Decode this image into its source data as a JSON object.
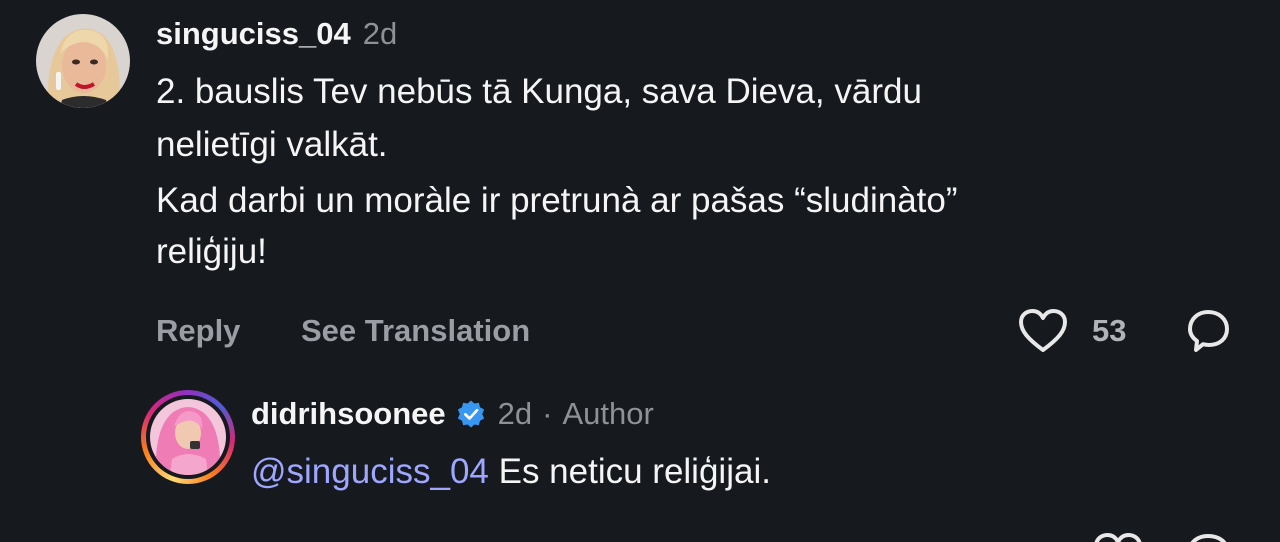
{
  "comments": [
    {
      "username": "singuciss_04",
      "time": "2d",
      "lines": [
        "2. bauslis Tev nebūs tā Kunga, sava Dieva, vārdu",
        "nelietīgi valkāt.",
        "Kad darbi un moràle ir pretrunà ar pašas “sludinàto”",
        "reliģiju!"
      ],
      "reply_label": "Reply",
      "translate_label": "See Translation",
      "likes": "53",
      "icons": [
        "avatar",
        "heart-icon",
        "chat-bubble-icon"
      ]
    },
    {
      "username": "didrihsoonee",
      "verified": true,
      "time": "2d",
      "separator": "·",
      "author_label": "Author",
      "mention": "@singuciss_04",
      "text": " Es neticu reliģijai.",
      "icons": [
        "avatar",
        "verified-badge-icon"
      ]
    }
  ],
  "colors": {
    "background": "#16191e",
    "text": "#f5f5f5",
    "muted": "#8e9196",
    "mention": "#9fa6ff",
    "verified": "#3897f0"
  }
}
